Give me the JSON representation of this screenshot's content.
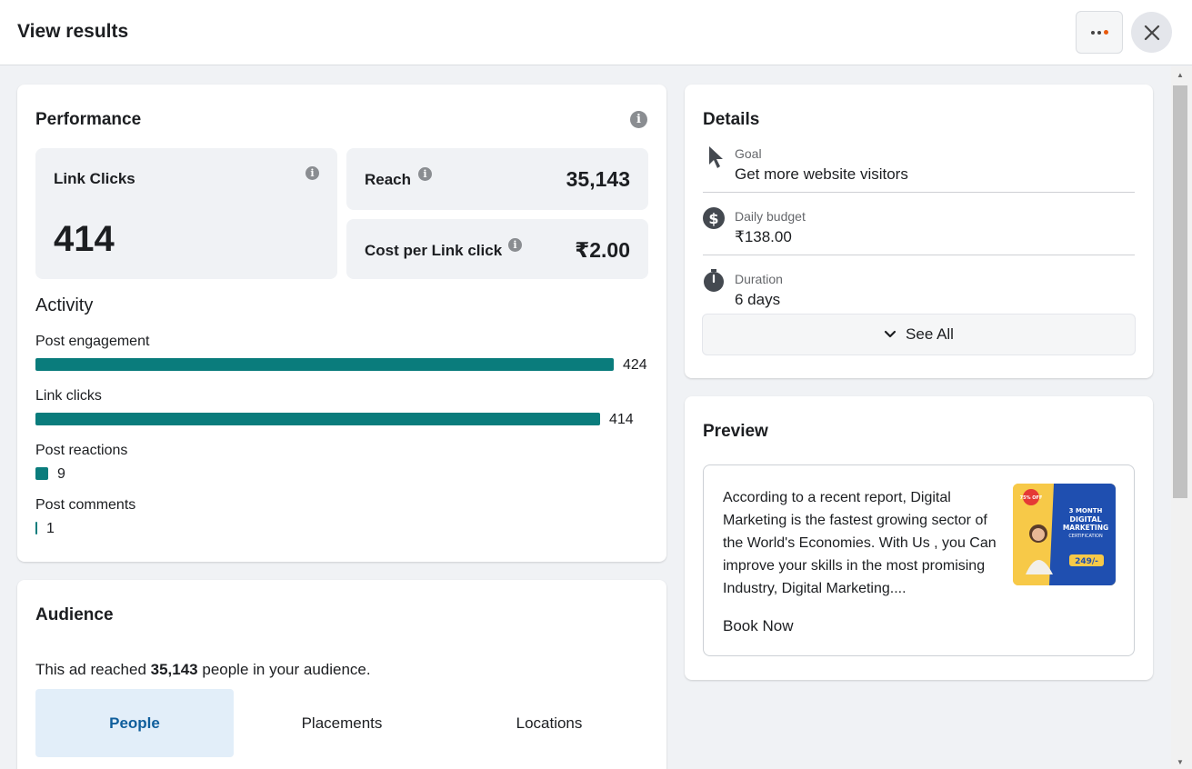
{
  "header": {
    "title": "View results"
  },
  "performance": {
    "title": "Performance",
    "link_clicks": {
      "label": "Link Clicks",
      "value": "414"
    },
    "reach": {
      "label": "Reach",
      "value": "35,143"
    },
    "cost_per_click": {
      "label": "Cost per Link click",
      "value": "₹2.00"
    }
  },
  "activity": {
    "title": "Activity",
    "max": 424,
    "items": [
      {
        "label": "Post engagement",
        "value": "424",
        "count": 424
      },
      {
        "label": "Link clicks",
        "value": "414",
        "count": 414
      },
      {
        "label": "Post reactions",
        "value": "9",
        "count": 9
      },
      {
        "label": "Post comments",
        "value": "1",
        "count": 1
      }
    ]
  },
  "audience": {
    "title": "Audience",
    "text_prefix": "This ad reached ",
    "reach_count": "35,143",
    "text_suffix": " people in your audience.",
    "tabs": [
      {
        "label": "People",
        "active": true
      },
      {
        "label": "Placements",
        "active": false
      },
      {
        "label": "Locations",
        "active": false
      }
    ]
  },
  "details": {
    "title": "Details",
    "goal": {
      "label": "Goal",
      "value": "Get more website visitors",
      "icon": "cursor-icon"
    },
    "budget": {
      "label": "Daily budget",
      "value": "₹138.00",
      "icon": "dollar-icon"
    },
    "duration": {
      "label": "Duration",
      "value": "6 days",
      "icon": "stopwatch-icon"
    },
    "see_all": "See All"
  },
  "preview": {
    "title": "Preview",
    "text": "According to a recent report, Digital Marketing is the fastest growing sector of the World's Economies. With Us , you Can improve your skills in the most promising Industry, Digital Marketing....",
    "cta": "Book Now",
    "image": {
      "badge": "75% OFF",
      "line1": "3 MONTH",
      "line2": "DIGITAL",
      "line3": "MARKETING",
      "line4": "CERTIFICATION",
      "price": "249/-"
    }
  },
  "colors": {
    "bar": "#0a7c7c",
    "active_tab_bg": "#e2eef9",
    "active_tab_text": "#0f5e9c",
    "accent_orange": "#e8590c"
  }
}
